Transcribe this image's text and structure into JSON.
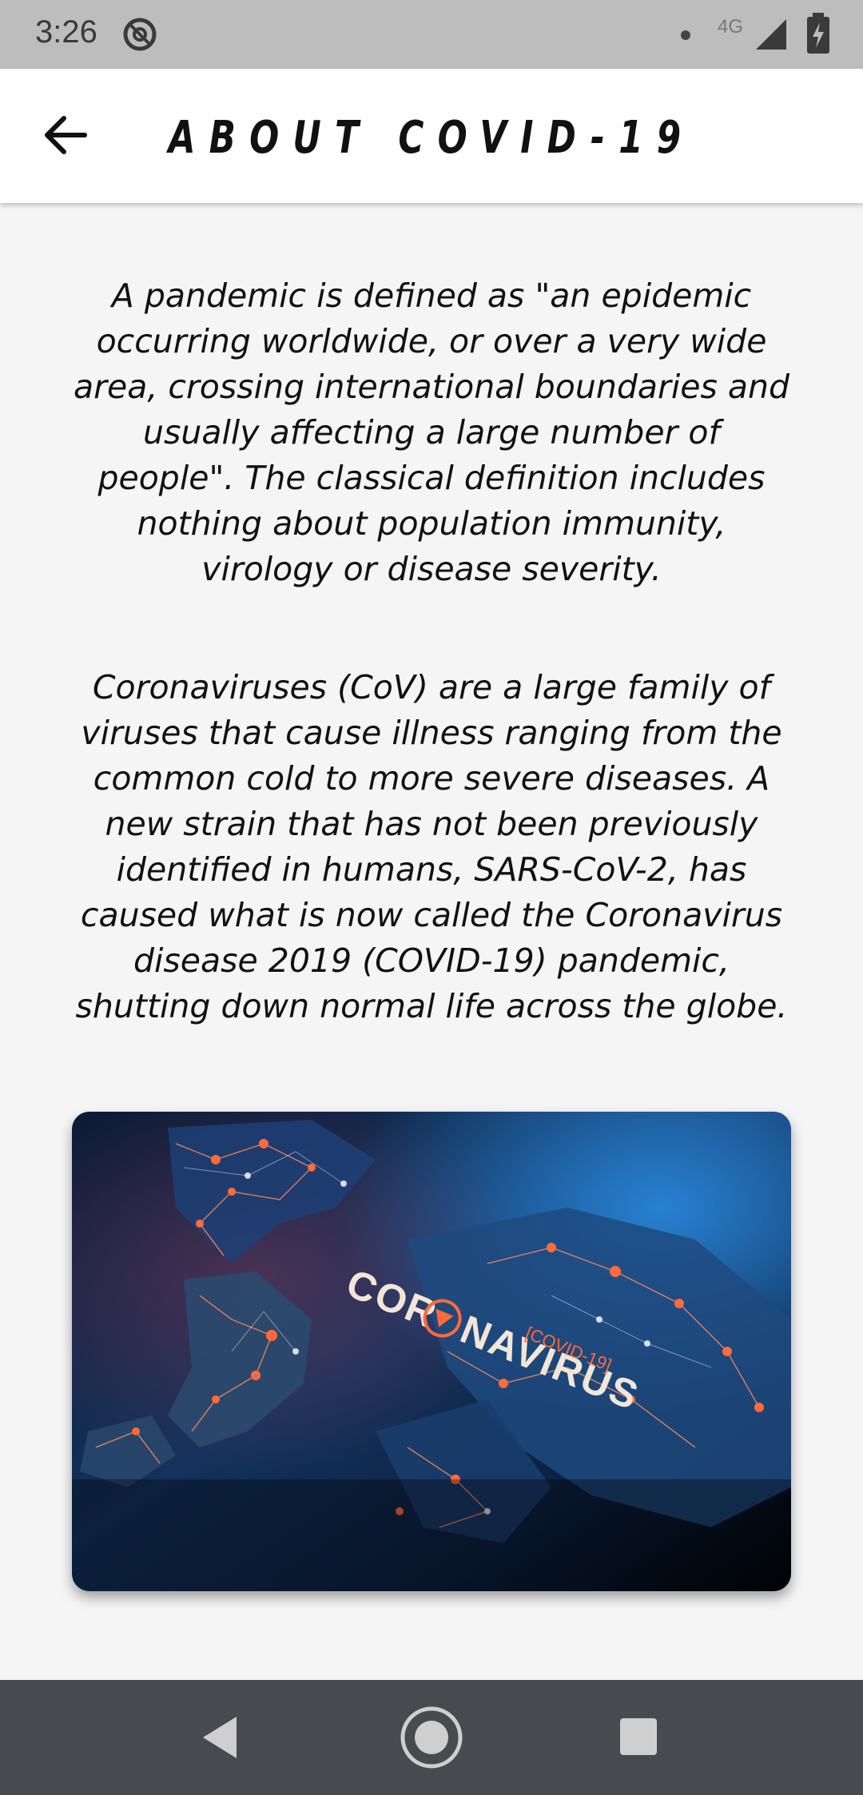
{
  "status_bar": {
    "time": "3:26",
    "network": "4G",
    "icons": [
      "app-notification-icon",
      "dot-icon",
      "signal-icon",
      "battery-charging-icon"
    ]
  },
  "app_bar": {
    "title": "ABOUT COVID-19",
    "back_icon": "arrow-back-icon"
  },
  "content": {
    "paragraph_1": "A pandemic is defined as \"an epidemic occurring worldwide, or over a very wide area, crossing international boundaries and usually affecting a large number of people\". The classical definition includes nothing about population immunity, virology or disease severity.",
    "paragraph_2": "Coronaviruses (CoV) are a large family of viruses that cause illness ranging from the common cold to more severe diseases. A new strain that has not been previously identified in humans, SARS-CoV-2, has caused what is now called the Coronavirus disease 2019 (COVID-19) pandemic, shutting down normal life across the globe.",
    "image": {
      "word_part_1": "COR",
      "word_part_2": "NAVIRUS",
      "tag": "[COVID-19]"
    }
  },
  "nav_bar": {
    "icons": [
      "nav-back-icon",
      "nav-home-icon",
      "nav-recents-icon"
    ]
  },
  "colors": {
    "status_bar": "#bdbdbd",
    "app_bar": "#ffffff",
    "background": "#f5f5f5",
    "nav_bar": "#474b50",
    "image_accent": "#ff6a3a"
  }
}
